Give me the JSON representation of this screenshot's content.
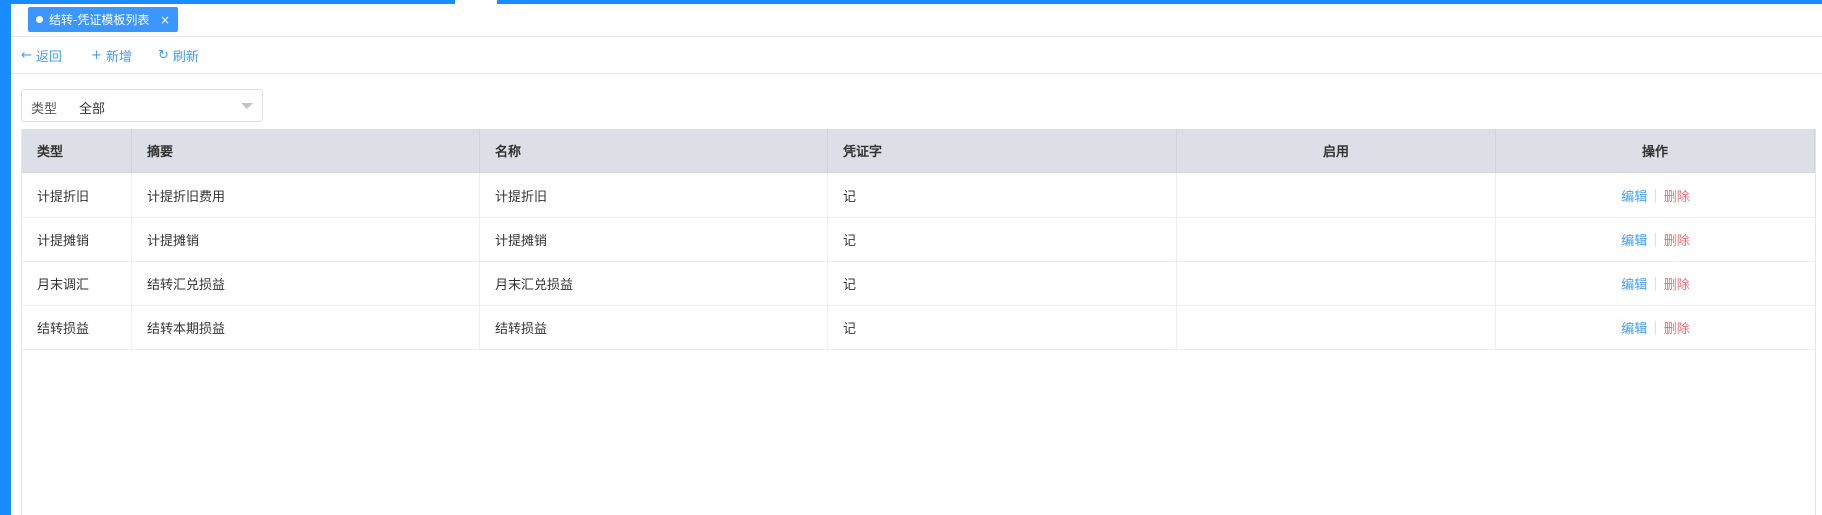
{
  "tab": {
    "title": "结转-凭证模板列表",
    "close": "×"
  },
  "toolbar": {
    "back_icon": "←",
    "back_label": "返回",
    "add_icon": "+",
    "add_label": "新增",
    "refresh_icon": "↻",
    "refresh_label": "刷新"
  },
  "filter": {
    "label": "类型",
    "value": "全部"
  },
  "table": {
    "columns": [
      "类型",
      "摘要",
      "名称",
      "凭证字",
      "启用",
      "操作"
    ],
    "rows": [
      {
        "type": "计提折旧",
        "summary": "计提折旧费用",
        "name": "计提折旧",
        "voucher": "记",
        "enabled": ""
      },
      {
        "type": "计提摊销",
        "summary": "计提摊销",
        "name": "计提摊销",
        "voucher": "记",
        "enabled": ""
      },
      {
        "type": "月末调汇",
        "summary": "结转汇兑损益",
        "name": "月末汇兑损益",
        "voucher": "记",
        "enabled": ""
      },
      {
        "type": "结转损益",
        "summary": "结转本期损益",
        "name": "结转损益",
        "voucher": "记",
        "enabled": ""
      }
    ],
    "actions": {
      "edit": "编辑",
      "sep": "|",
      "delete": "删除"
    }
  },
  "colors": {
    "accent": "#409eff",
    "brand_strip": "#1a8cff",
    "danger": "#f56c6c",
    "header_bg": "#dcdfe5"
  },
  "icons": {
    "back": "arrow-left-icon",
    "add": "plus-icon",
    "refresh": "refresh-icon",
    "dropdown": "caret-down-icon"
  }
}
